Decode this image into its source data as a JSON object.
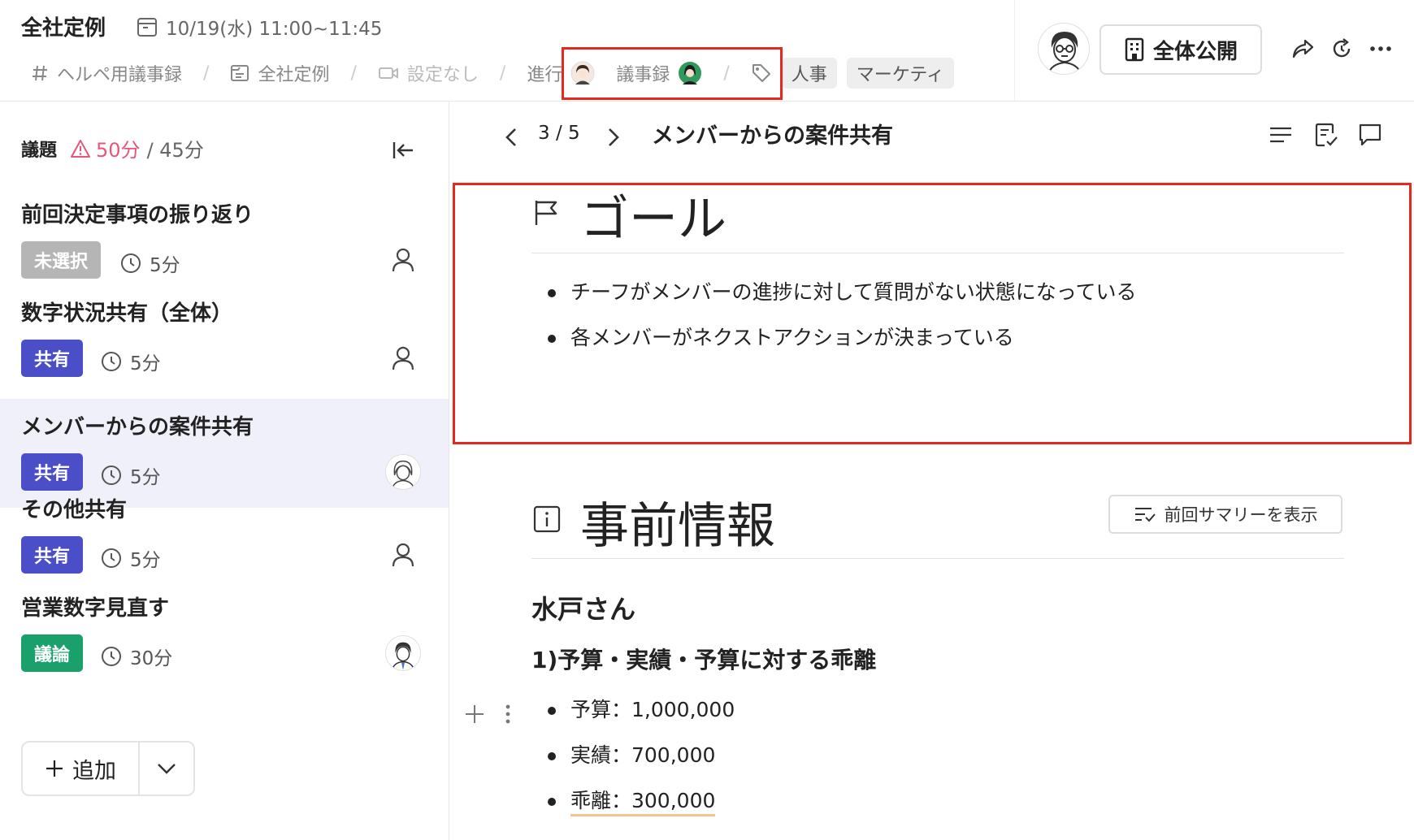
{
  "header": {
    "title": "全社定例",
    "datetime": "10/19(水) 11:00~11:45",
    "breadcrumbs": {
      "channel": "ヘルペ用議事録",
      "template": "全社定例",
      "video": "設定なし",
      "facilitator_label": "進行",
      "minutes_label": "議事録"
    },
    "tags": [
      "人事",
      "マーケティ"
    ],
    "publish_label": "全体公開"
  },
  "sidebar": {
    "heading": "議題",
    "over_time": "50分",
    "total_time": "/ 45分",
    "items": [
      {
        "title": "前回決定事項の振り返り",
        "badge": "未選択",
        "badge_color": "#b5b5b5",
        "time": "5分"
      },
      {
        "title": "数字状況共有（全体）",
        "badge": "共有",
        "badge_color": "#4a4fc7",
        "time": "5分"
      },
      {
        "title": "メンバーからの案件共有",
        "badge": "共有",
        "badge_color": "#4a4fc7",
        "time": "5分"
      },
      {
        "title": "その他共有",
        "badge": "共有",
        "badge_color": "#4a4fc7",
        "time": "5分"
      },
      {
        "title": "営業数字見直す",
        "badge": "議論",
        "badge_color": "#1aa06b",
        "time": "30分"
      }
    ],
    "add_label": "追加"
  },
  "main": {
    "pager": "3 / 5",
    "section_title": "メンバーからの案件共有",
    "goal_heading": "ゴール",
    "goals": [
      "チーフがメンバーの進捗に対して質問がない状態になっている",
      "各メンバーがネクストアクションが決まっている"
    ],
    "pre_heading": "事前情報",
    "summary_button": "前回サマリーを表示",
    "person": "水戸さん",
    "subheading": "1)予算・実績・予算に対する乖離",
    "figures": [
      "予算：1,000,000",
      "実績：700,000",
      "乖離：300,000"
    ]
  },
  "colors": {
    "accent_red": "#e8281e",
    "warn_pink": "#e8557a",
    "share_blue": "#4a4fc7",
    "discuss_green": "#1aa06b",
    "unselected_gray": "#b5b5b5",
    "active_row": "#f0f0fa"
  },
  "icons": [
    "calendar-icon",
    "hash-icon",
    "document-icon",
    "video-icon",
    "tag-icon",
    "share-icon",
    "refresh-icon",
    "more-icon",
    "warning-icon",
    "collapse-icon",
    "clock-icon",
    "user-icon",
    "flag-icon",
    "info-icon",
    "toc-icon",
    "checklist-icon",
    "comment-icon"
  ]
}
